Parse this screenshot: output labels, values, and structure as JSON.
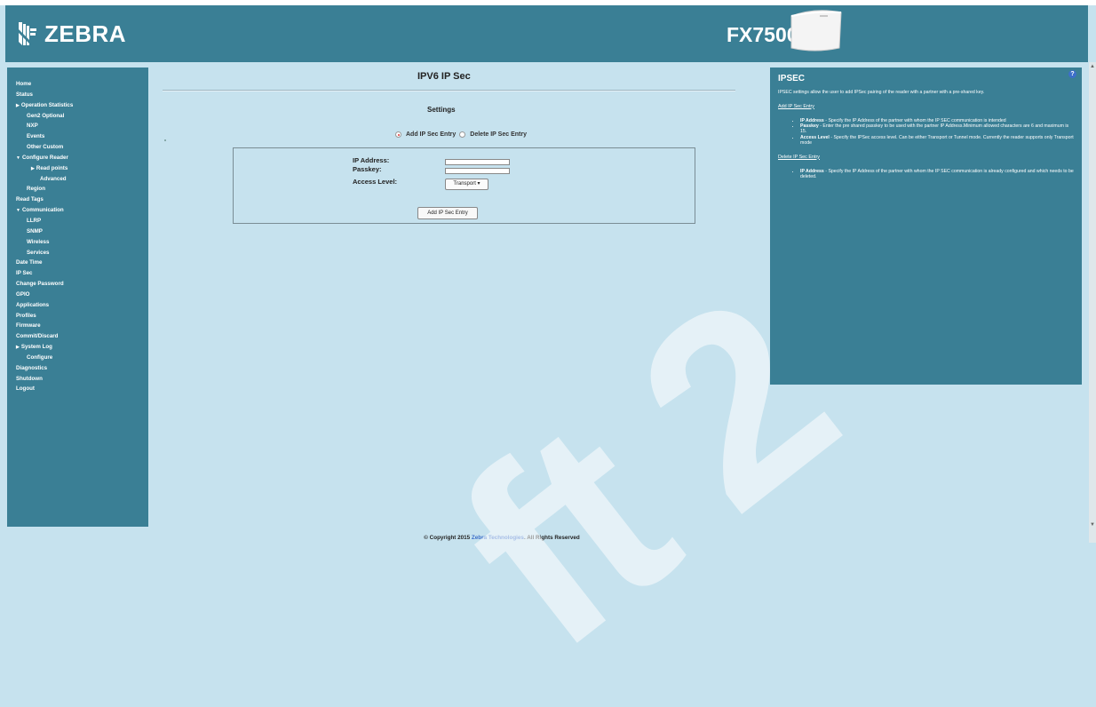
{
  "header": {
    "logo_text": "ZEBRA",
    "model": "FX7500"
  },
  "sidebar": {
    "items": [
      {
        "label": "Home",
        "level": 0,
        "caret": ""
      },
      {
        "label": "Status",
        "level": 0,
        "caret": ""
      },
      {
        "label": "Operation Statistics",
        "level": 0,
        "caret": "▶"
      },
      {
        "label": "Gen2 Optional",
        "level": 1,
        "caret": ""
      },
      {
        "label": "NXP",
        "level": 1,
        "caret": ""
      },
      {
        "label": "Events",
        "level": 1,
        "caret": ""
      },
      {
        "label": "Other Custom",
        "level": 1,
        "caret": ""
      },
      {
        "label": "Configure Reader",
        "level": 0,
        "caret": "▼"
      },
      {
        "label": "Read points",
        "level": 2,
        "caret": "▶"
      },
      {
        "label": "Advanced",
        "level": 3,
        "caret": ""
      },
      {
        "label": "Region",
        "level": 1,
        "caret": ""
      },
      {
        "label": "Read Tags",
        "level": 0,
        "caret": ""
      },
      {
        "label": "Communication",
        "level": 0,
        "caret": "▼"
      },
      {
        "label": "LLRP",
        "level": 1,
        "caret": ""
      },
      {
        "label": "SNMP",
        "level": 1,
        "caret": ""
      },
      {
        "label": "Wireless",
        "level": 1,
        "caret": ""
      },
      {
        "label": "Services",
        "level": 1,
        "caret": ""
      },
      {
        "label": "Date Time",
        "level": 0,
        "caret": ""
      },
      {
        "label": "IP Sec",
        "level": 0,
        "caret": ""
      },
      {
        "label": "Change Password",
        "level": 0,
        "caret": ""
      },
      {
        "label": "GPIO",
        "level": 0,
        "caret": ""
      },
      {
        "label": "Applications",
        "level": 0,
        "caret": ""
      },
      {
        "label": "Profiles",
        "level": 0,
        "caret": ""
      },
      {
        "label": "Firmware",
        "level": 0,
        "caret": ""
      },
      {
        "label": "Commit/Discard",
        "level": 0,
        "caret": ""
      },
      {
        "label": "System Log",
        "level": 0,
        "caret": "▶"
      },
      {
        "label": "Configure",
        "level": 1,
        "caret": ""
      },
      {
        "label": "Diagnostics",
        "level": 0,
        "caret": ""
      },
      {
        "label": "Shutdown",
        "level": 0,
        "caret": ""
      },
      {
        "label": "Logout",
        "level": 0,
        "caret": ""
      }
    ]
  },
  "main": {
    "title": "IPV6 IP Sec",
    "settings_title": "Settings",
    "radio_add": "Add IP Sec Entry",
    "radio_delete": "Delete IP Sec Entry",
    "radio_selected": "add",
    "ip_label": "IP Address:",
    "passkey_label": "Passkey:",
    "access_label": "Access Level:",
    "ip_value": "",
    "passkey_value": "",
    "access_value": "Transport ▾",
    "submit_label": "Add IP Sec Entry"
  },
  "help": {
    "title": "IPSEC",
    "intro": "IPSEC settings allow the user to add IPSec pairing of the reader with a partner with a pre-shared key.",
    "add_link": "Add IP Sec Entry",
    "add_items": [
      {
        "term": "IP Address",
        "text": " - Specify the IP Address of the partner with whom the IP SEC communication is intended"
      },
      {
        "term": "Passkey",
        "text": " - Enter the pre shared passkey to be used with the partner IP Address.Minimum allowed characters are 6 and maximum is 15."
      },
      {
        "term": "Access Level",
        "text": " - Specify the IPSec access level. Can be either Transport or Tunnel mode. Currently the reader supports only Transport mode"
      }
    ],
    "delete_link": "Delete IP Sec Entry",
    "delete_items": [
      {
        "term": "IP Address",
        "text": " - Specify the IP Address of the partner with whom the IP SEC communication is already configured and which needs to be deleted."
      }
    ]
  },
  "footer": {
    "prefix": "© Copyright 2015 ",
    "brand": "Zebra Technologies",
    "suffix": ". All Rights Reserved"
  },
  "watermark": "ft 2",
  "colors": {
    "header_bg": "#3a7f95",
    "page_bg": "#c6e2ee",
    "link": "#3d6fc9"
  }
}
